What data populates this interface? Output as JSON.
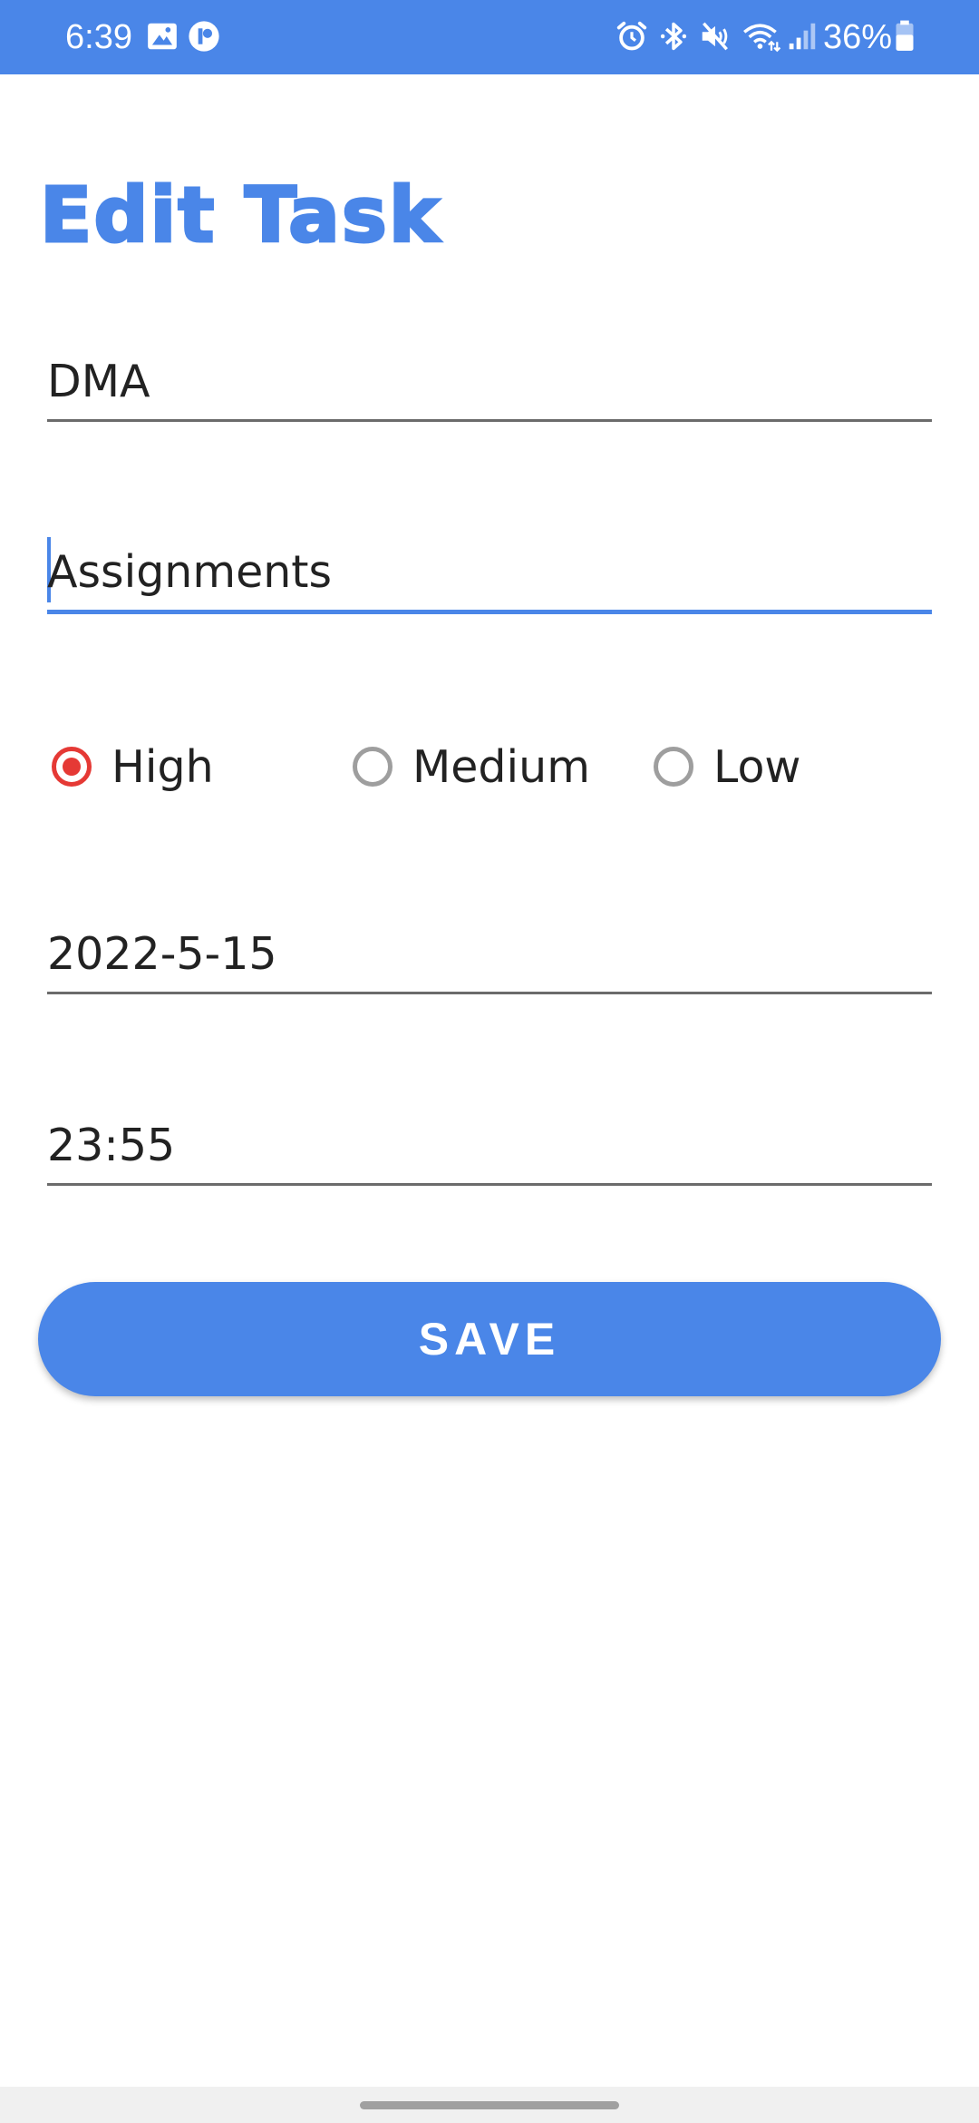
{
  "status_bar": {
    "time": "6:39",
    "battery": "36%",
    "left_icons": [
      "gallery-icon",
      "app-notification-icon"
    ],
    "right_icons": [
      "alarm-icon",
      "bluetooth-icon",
      "vibrate-mute-icon",
      "wifi-icon",
      "signal-icon",
      "battery-icon"
    ],
    "color": "#4a86e8"
  },
  "title": "Edit Task",
  "fields": {
    "name": {
      "value": "DMA"
    },
    "description": {
      "value": "Assignments"
    },
    "date": {
      "value": "2022-5-15"
    },
    "time": {
      "value": "23:55"
    }
  },
  "priority": {
    "options": [
      "High",
      "Medium",
      "Low"
    ],
    "selected": "High"
  },
  "save_label": "SAVE",
  "colors": {
    "accent": "#4a86e8",
    "radio_checked": "#e53935",
    "radio_unchecked": "#9e9e9e"
  }
}
